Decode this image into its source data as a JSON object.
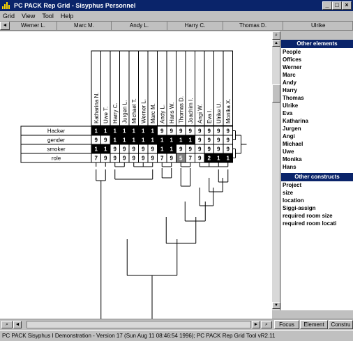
{
  "window": {
    "title": "PC PACK Rep Grid - Sisyphus Personnel",
    "minimize_glyph": "_",
    "maximize_glyph": "□",
    "close_glyph": "×"
  },
  "menu": [
    {
      "label": "Grid"
    },
    {
      "label": "View"
    },
    {
      "label": "Tool"
    },
    {
      "label": "Help"
    }
  ],
  "element_header": [
    "Werner L.",
    "Marc M.",
    "Andy L.",
    "Harry C.",
    "Thomas D.",
    "Ulrike"
  ],
  "grid": {
    "elements": [
      "Katharina N.",
      "Uwe T.",
      "Harry C.",
      "Jurgen L.",
      "Michael T.",
      "Werner L.",
      "Marc M.",
      "Andy L.",
      "Hans W.",
      "Thomas D.",
      "Joachim I.",
      "Angi W.",
      "Eva I.",
      "Ulrike U.",
      "Monika X."
    ],
    "constructs": [
      "Hacker",
      "gender",
      "smoker",
      "role"
    ],
    "values": [
      [
        "1",
        "1",
        "1",
        "1",
        "1",
        "1",
        "1",
        "9",
        "9",
        "9",
        "9",
        "9",
        "9",
        "9",
        "9"
      ],
      [
        "9",
        "9",
        "1",
        "1",
        "1",
        "1",
        "1",
        "1",
        "1",
        "1",
        "1",
        "9",
        "9",
        "9",
        "9"
      ],
      [
        "1",
        "1",
        "9",
        "9",
        "9",
        "9",
        "9",
        "1",
        "1",
        "9",
        "9",
        "9",
        "9",
        "9",
        "9"
      ],
      [
        "7",
        "9",
        "9",
        "9",
        "9",
        "9",
        "9",
        "7",
        "9",
        "5",
        "7",
        "9",
        "2",
        "1",
        "1"
      ]
    ]
  },
  "right_panel": {
    "elements_header": "Other elements",
    "elements": [
      "People",
      "Offices",
      "Werner",
      "Marc",
      "Andy",
      "Harry",
      "Thomas",
      "Ulrike",
      "Eva",
      "Katharina",
      "Jurgen",
      "Angi",
      "Michael",
      "Uwe",
      "Monika",
      "Hans"
    ],
    "constructs_header": "Other constructs",
    "constructs": [
      "Project",
      "size",
      "location",
      "Siggi-assign",
      "required room size",
      "required room locati"
    ]
  },
  "bottom_tabs": [
    {
      "label": "Focus"
    },
    {
      "label": "Element"
    },
    {
      "label": "Constru"
    }
  ],
  "status": "PC PACK Sisyphus I Demonstration - Version 17 (Sun Aug 11 08:46:54 1996); PC PACK Rep Grid Tool vR2.11",
  "colors": {
    "titlebar": "#0a246a",
    "cell_dark": "#000000",
    "cell_mid": "#404040",
    "cell_grey": "#808080",
    "cell_light": "#ffffff"
  }
}
